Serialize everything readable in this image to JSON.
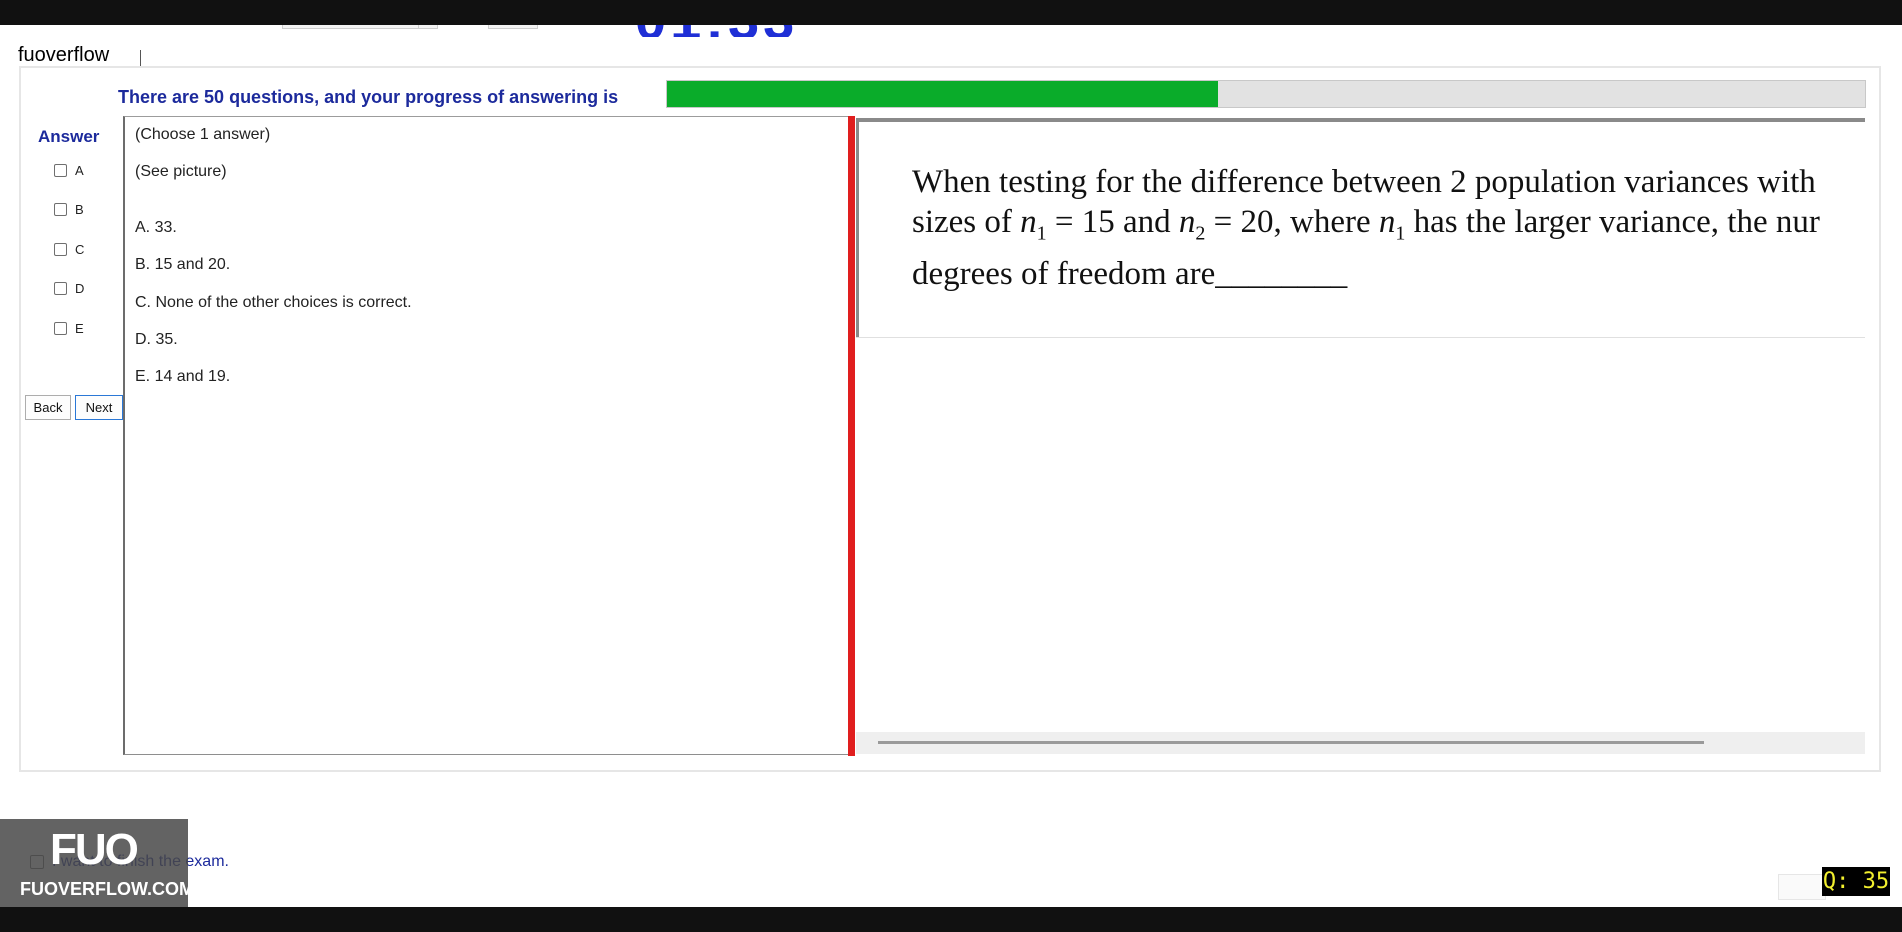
{
  "header": {
    "app_name": "fuoverflow"
  },
  "progress": {
    "label": "There are 50 questions, and your progress of answering is",
    "fraction": 0.46,
    "fill_color": "#0aac2a"
  },
  "answer_panel": {
    "title": "Answer",
    "options": [
      "A",
      "B",
      "C",
      "D",
      "E"
    ]
  },
  "nav": {
    "back_label": "Back",
    "next_label": "Next"
  },
  "question_text_panel": {
    "lines": [
      "(Choose 1 answer)",
      "(See picture)",
      "A. 33.",
      "B. 15 and 20.",
      "C. None of the other choices is correct.",
      "D. 35.",
      "E. 14 and 19."
    ]
  },
  "question_image": {
    "line1": "When testing for the difference between 2 population variances with",
    "line2_a": "sizes of ",
    "line2_b": " = 15 and ",
    "line2_c": " = 20, where ",
    "line2_d": " has the larger variance, the nur",
    "line3": "degrees of freedom are________",
    "n": "n",
    "sub1": "1",
    "sub2": "2"
  },
  "finish": {
    "label": "I want to finish the exam."
  },
  "watermark": {
    "logo": "FUO",
    "text": "FUOVERFLOW.COM"
  },
  "question_badge": "Q: 35",
  "colors": {
    "accent_blue": "#1c2a9c",
    "divider_red": "#e01e1e",
    "badge_text": "#f2ef2e"
  }
}
